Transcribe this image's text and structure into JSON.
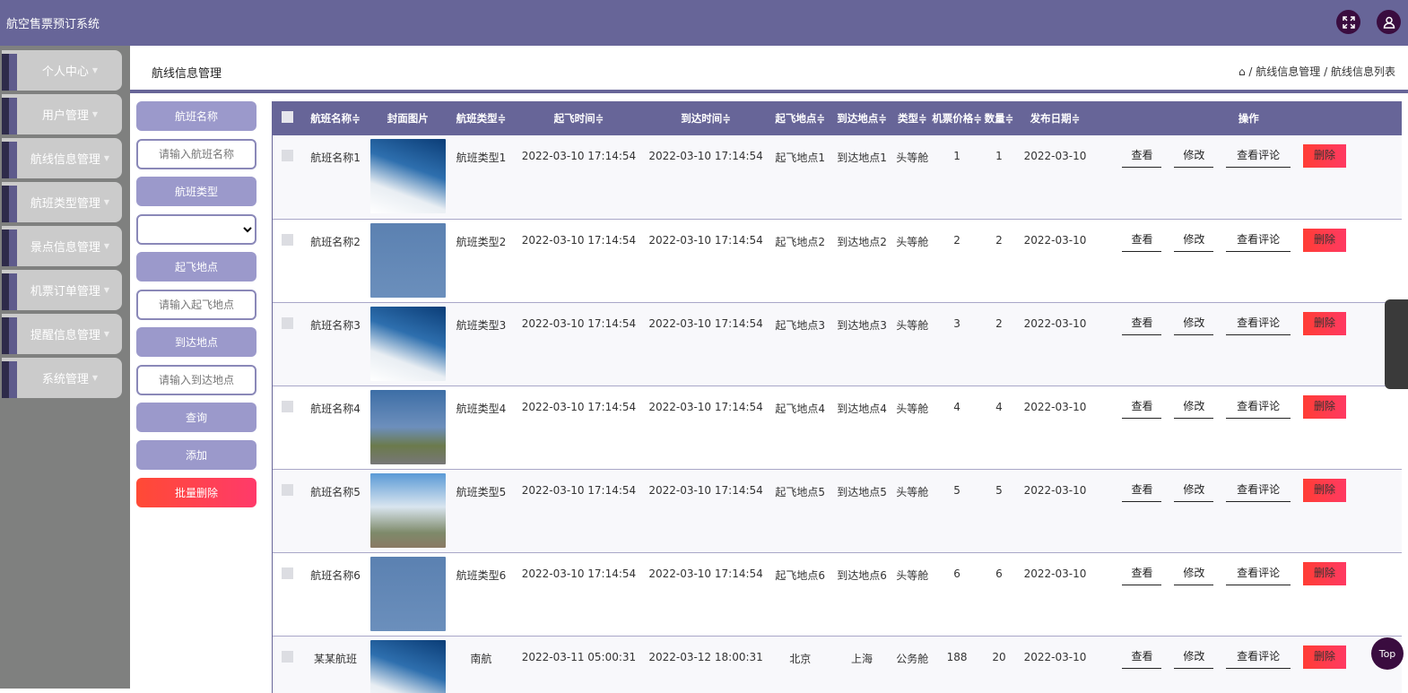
{
  "app": {
    "title": "航空售票预订系统"
  },
  "sidebar": {
    "items": [
      {
        "label": "个人中心"
      },
      {
        "label": "用户管理"
      },
      {
        "label": "航线信息管理"
      },
      {
        "label": "航班类型管理"
      },
      {
        "label": "景点信息管理"
      },
      {
        "label": "机票订单管理"
      },
      {
        "label": "提醒信息管理"
      },
      {
        "label": "系统管理"
      }
    ]
  },
  "header": {
    "title": "航线信息管理",
    "breadcrumb": [
      "航线信息管理",
      "航线信息列表"
    ],
    "sep": "/"
  },
  "filters": {
    "name_label": "航班名称",
    "name_placeholder": "请输入航班名称",
    "type_label": "航班类型",
    "type_value": "",
    "from_label": "起飞地点",
    "from_placeholder": "请输入起飞地点",
    "to_label": "到达地点",
    "to_placeholder": "请输入到达地点",
    "search": "查询",
    "add": "添加",
    "batch_delete": "批量删除"
  },
  "table": {
    "columns": [
      "航班名称≑",
      "封面图片",
      "航班类型≑",
      "起飞时间≑",
      "到达时间≑",
      "起飞地点≑",
      "到达地点≑",
      "类型≑",
      "机票价格≑",
      "数量≑",
      "发布日期≑",
      "操作"
    ],
    "actions": {
      "view": "查看",
      "edit": "修改",
      "comments": "查看评论",
      "delete": "删除"
    },
    "rows": [
      {
        "name": "航班名称1",
        "type": "航班类型1",
        "depart": "2022-03-10 17:14:54",
        "arrive": "2022-03-10 17:14:54",
        "from": "起飞地点1",
        "to": "到达地点1",
        "cabin": "头等舱",
        "price": "1",
        "qty": "1",
        "date": "2022-03-10",
        "img": "img1"
      },
      {
        "name": "航班名称2",
        "type": "航班类型2",
        "depart": "2022-03-10 17:14:54",
        "arrive": "2022-03-10 17:14:54",
        "from": "起飞地点2",
        "to": "到达地点2",
        "cabin": "头等舱",
        "price": "2",
        "qty": "2",
        "date": "2022-03-10",
        "img": "img2"
      },
      {
        "name": "航班名称3",
        "type": "航班类型3",
        "depart": "2022-03-10 17:14:54",
        "arrive": "2022-03-10 17:14:54",
        "from": "起飞地点3",
        "to": "到达地点3",
        "cabin": "头等舱",
        "price": "3",
        "qty": "2",
        "date": "2022-03-10",
        "img": "img1"
      },
      {
        "name": "航班名称4",
        "type": "航班类型4",
        "depart": "2022-03-10 17:14:54",
        "arrive": "2022-03-10 17:14:54",
        "from": "起飞地点4",
        "to": "到达地点4",
        "cabin": "头等舱",
        "price": "4",
        "qty": "4",
        "date": "2022-03-10",
        "img": "img3"
      },
      {
        "name": "航班名称5",
        "type": "航班类型5",
        "depart": "2022-03-10 17:14:54",
        "arrive": "2022-03-10 17:14:54",
        "from": "起飞地点5",
        "to": "到达地点5",
        "cabin": "头等舱",
        "price": "5",
        "qty": "5",
        "date": "2022-03-10",
        "img": "img4"
      },
      {
        "name": "航班名称6",
        "type": "航班类型6",
        "depart": "2022-03-10 17:14:54",
        "arrive": "2022-03-10 17:14:54",
        "from": "起飞地点6",
        "to": "到达地点6",
        "cabin": "头等舱",
        "price": "6",
        "qty": "6",
        "date": "2022-03-10",
        "img": "img2"
      },
      {
        "name": "某某航班",
        "type": "南航",
        "depart": "2022-03-11 05:00:31",
        "arrive": "2022-03-12 18:00:31",
        "from": "北京",
        "to": "上海",
        "cabin": "公务舱",
        "price": "188",
        "qty": "20",
        "date": "2022-03-10",
        "img": "img1"
      }
    ]
  },
  "back_to_top": "Top"
}
